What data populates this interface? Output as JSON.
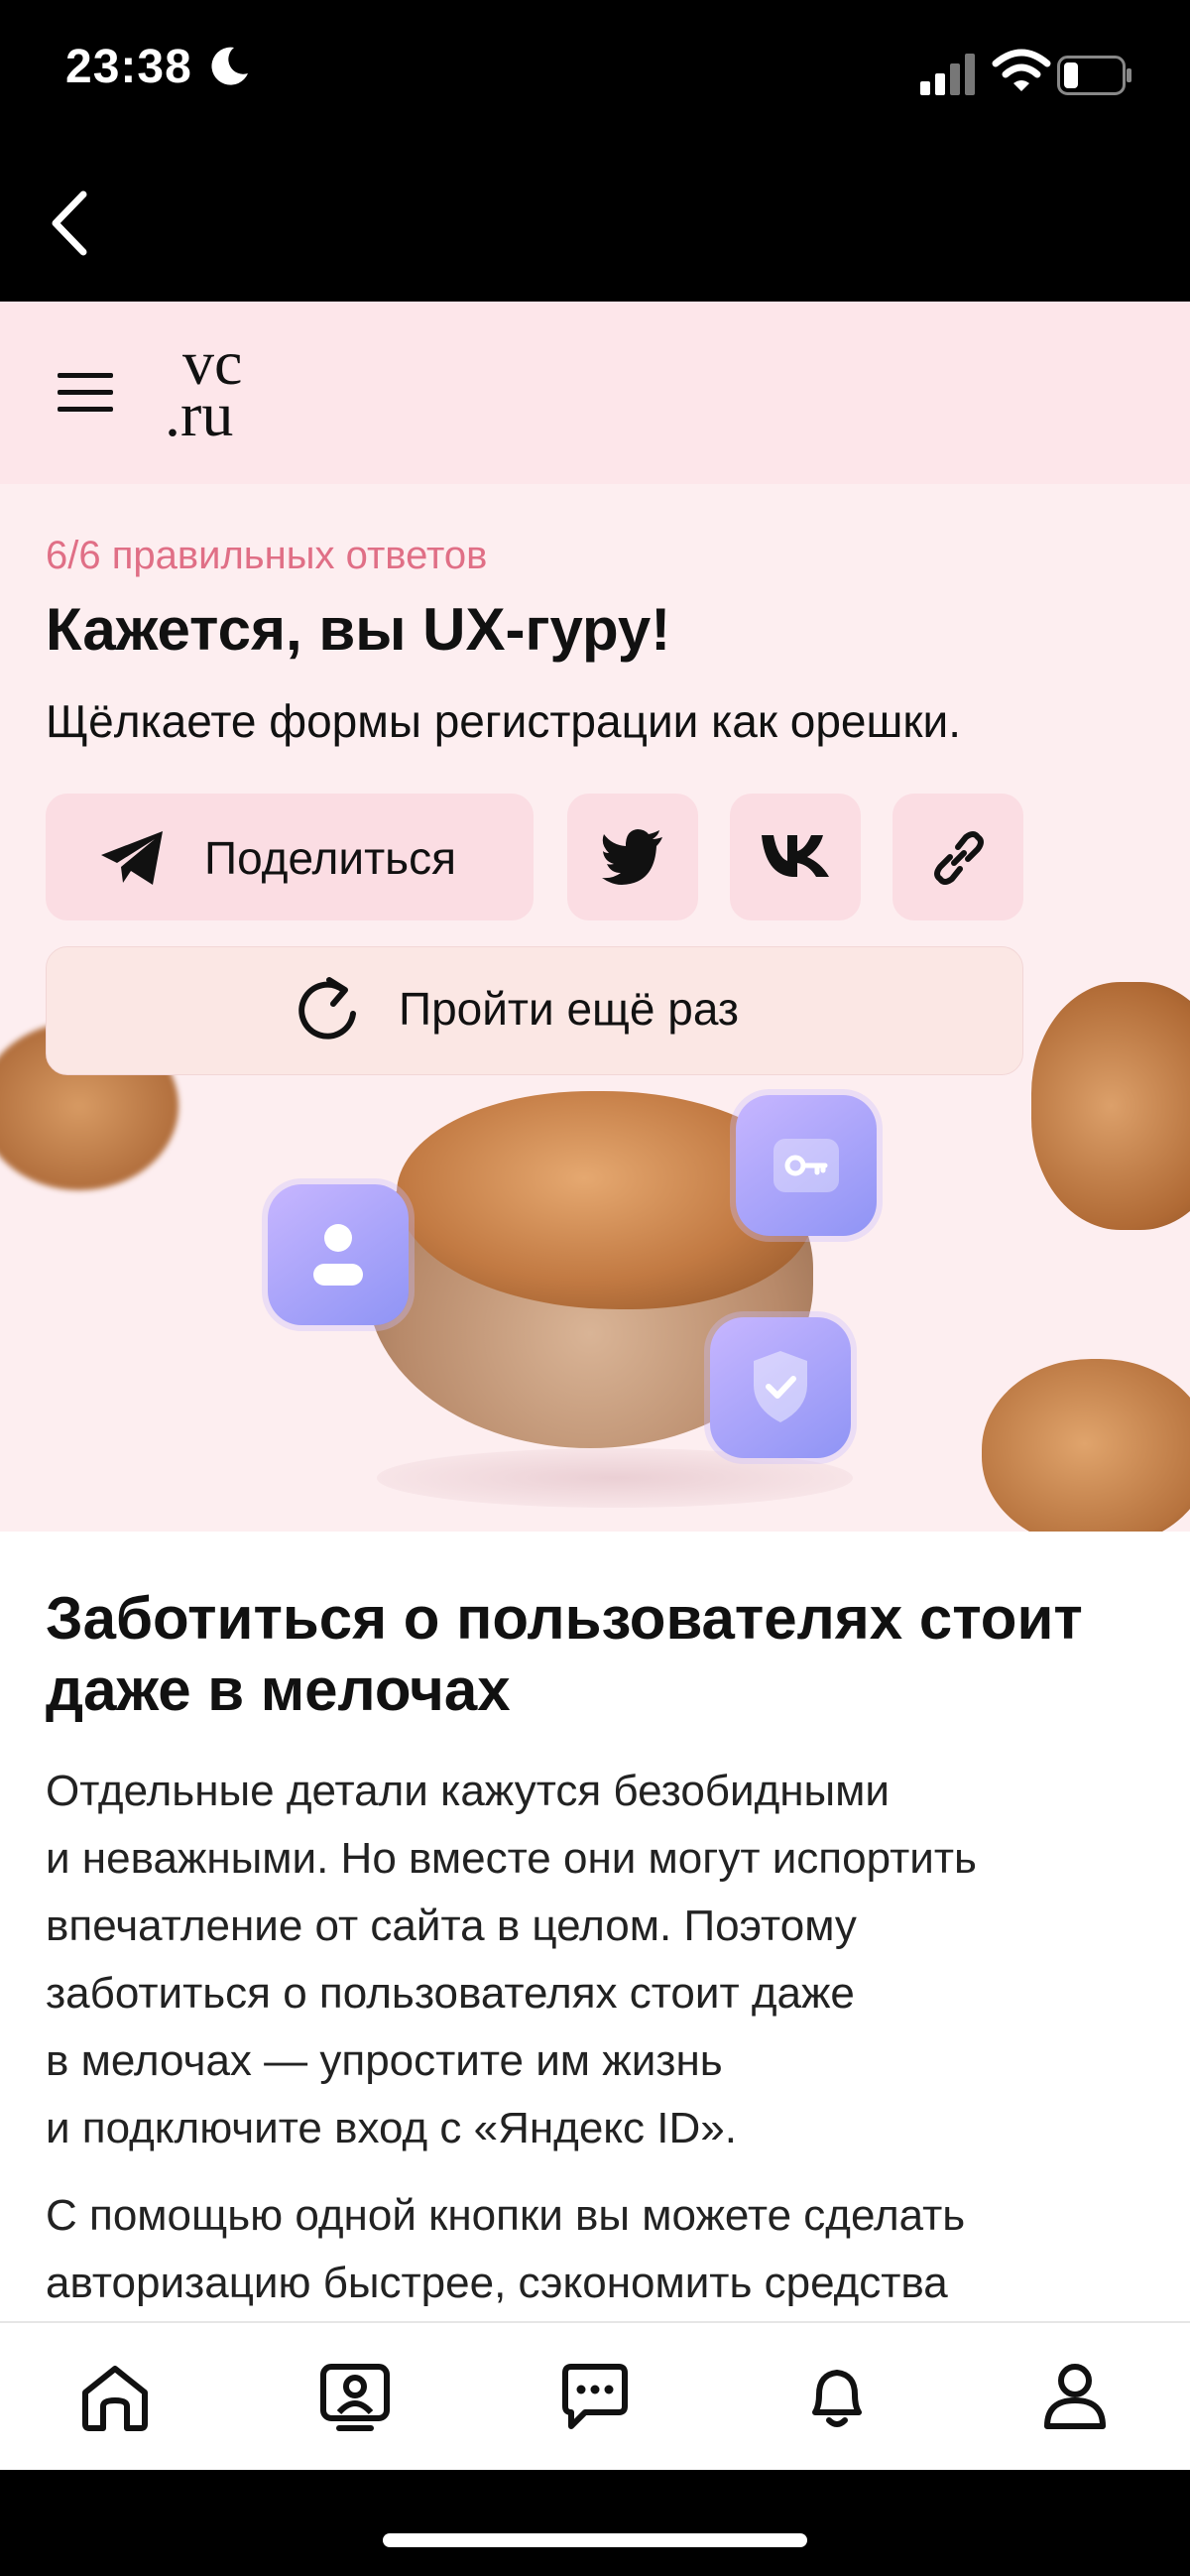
{
  "status_bar": {
    "time": "23:38"
  },
  "header": {
    "logo_line1": "vc",
    "logo_line2": ".ru"
  },
  "result": {
    "score": "6/6 правильных ответов",
    "title": "Кажется, вы UX-гуру!",
    "subtitle": "Щёлкаете формы регистрации как орешки.",
    "share_label": "Поделиться",
    "retry_label": "Пройти ещё раз"
  },
  "article": {
    "title": "Заботиться о пользователях стоит даже в мелочах",
    "paragraph1": "Отдельные детали кажутся безобидными\nи неважными. Но вместе они могут испортить\nвпечатление от сайта в целом. Поэтому\nзаботиться о пользователях стоит даже\nв мелочах — упростите им жизнь\nи подключите вход с «Яндекс ID».",
    "paragraph2": "С помощью одной кнопки вы можете сделать\nавторизацию быстрее, сэкономить средства"
  },
  "tabbar": {
    "items": [
      "home-icon",
      "profile-card-icon",
      "chat-icon",
      "bell-icon",
      "user-icon"
    ]
  },
  "colors": {
    "accent_pink": "#e06f86",
    "card_bg": "#fdeef0",
    "button_bg": "#fbdde3"
  }
}
